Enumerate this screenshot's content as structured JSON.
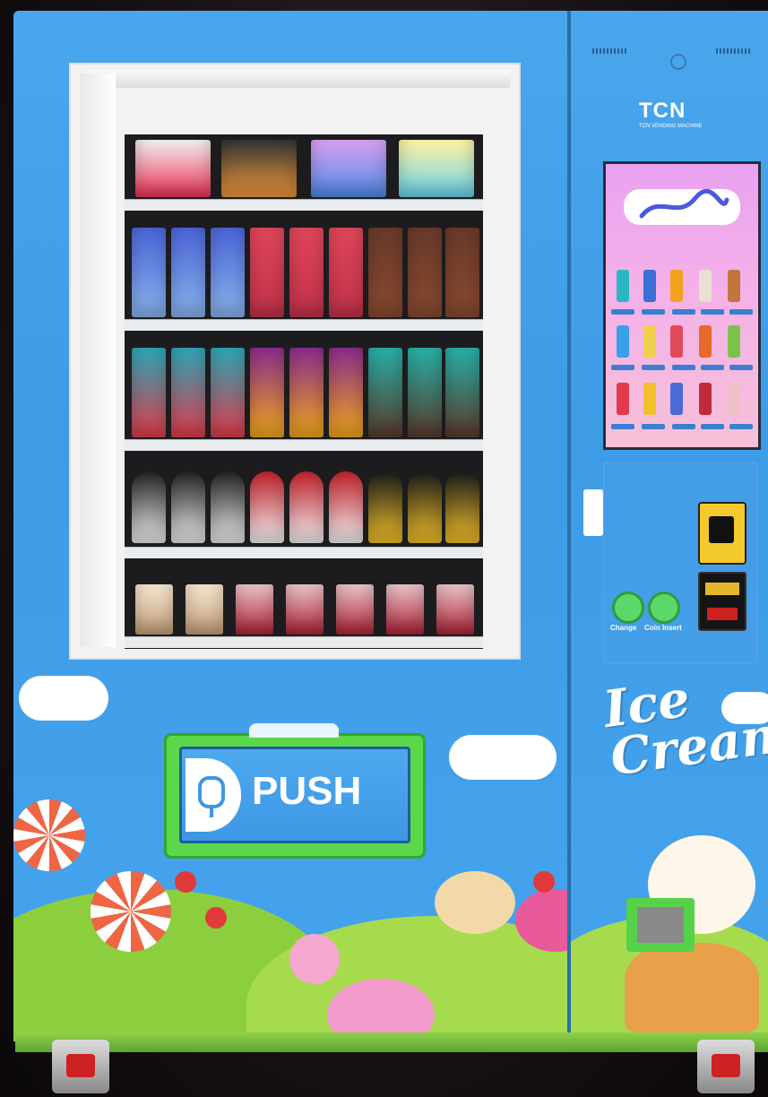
{
  "brand": {
    "logo": "TCN",
    "tagline": "TCN VENDING MACHINE"
  },
  "push_button": {
    "label": "PUSH",
    "icon": "ice-cream-icon"
  },
  "payment": {
    "change_label": "Change",
    "coin_insert_label": "Coin Insert"
  },
  "decoration": {
    "ice_cream_text": "Ice Cream"
  },
  "colors": {
    "body": "#46a3ec",
    "accent_green": "#5bd84a",
    "screen_pink": "#f3b0ea"
  }
}
